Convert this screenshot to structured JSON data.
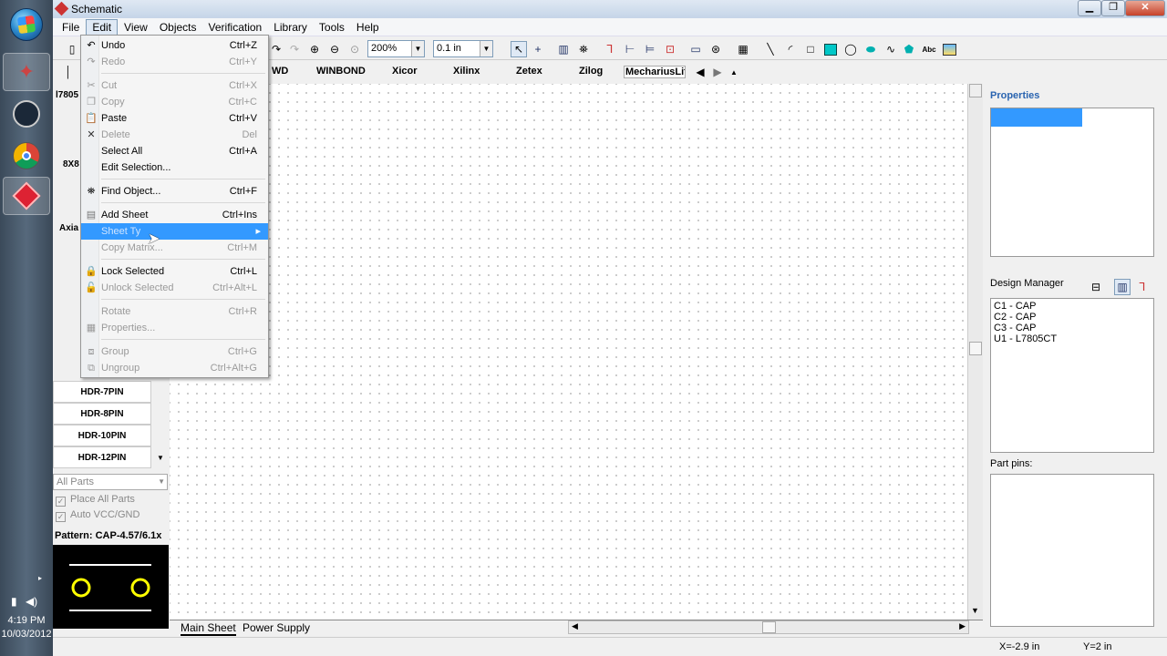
{
  "window": {
    "title": "Schematic"
  },
  "menubar": [
    "File",
    "Edit",
    "View",
    "Objects",
    "Verification",
    "Library",
    "Tools",
    "Help"
  ],
  "toolbar": {
    "zoom": "200%",
    "grid": "0.1 in"
  },
  "library_tabs": [
    "WD",
    "WINBOND",
    "Xicor",
    "Xilinx",
    "Zetex",
    "Zilog",
    "MechariusLit"
  ],
  "edit_menu": {
    "undo": "Undo",
    "undo_sc": "Ctrl+Z",
    "redo": "Redo",
    "redo_sc": "Ctrl+Y",
    "cut": "Cut",
    "cut_sc": "Ctrl+X",
    "copy": "Copy",
    "copy_sc": "Ctrl+C",
    "paste": "Paste",
    "paste_sc": "Ctrl+V",
    "delete": "Delete",
    "delete_sc": "Del",
    "select_all": "Select All",
    "select_all_sc": "Ctrl+A",
    "edit_selection": "Edit Selection...",
    "find_object": "Find Object...",
    "find_object_sc": "Ctrl+F",
    "add_sheet": "Add Sheet",
    "add_sheet_sc": "Ctrl+Ins",
    "sheet_type": "Sheet Ty",
    "copy_matrix": "Copy Matrix...",
    "copy_matrix_sc": "Ctrl+M",
    "lock_selected": "Lock Selected",
    "lock_selected_sc": "Ctrl+L",
    "unlock_selected": "Unlock Selected",
    "unlock_selected_sc": "Ctrl+Alt+L",
    "rotate": "Rotate",
    "rotate_sc": "Ctrl+R",
    "properties": "Properties...",
    "group": "Group",
    "group_sc": "Ctrl+G",
    "ungroup": "Ungroup",
    "ungroup_sc": "Ctrl+Alt+G"
  },
  "left_panel": {
    "partial_rows": [
      "l7805",
      "8X8",
      "Axia"
    ],
    "parts": [
      "HDR-7PIN",
      "HDR-8PIN",
      "HDR-10PIN",
      "HDR-12PIN"
    ],
    "filter": "All Parts",
    "place_all": "Place All Parts",
    "auto_vcc": "Auto VCC/GND",
    "pattern": "Pattern: CAP-4.57/6.1x"
  },
  "sheets": [
    "Main Sheet",
    "Power Supply"
  ],
  "right_panel": {
    "properties_title": "Properties",
    "design_manager_title": "Design Manager",
    "design_items": [
      "C1 - CAP",
      "C2 - CAP",
      "C3 - CAP",
      "U1 - L7805CT"
    ],
    "part_pins_title": "Part pins:"
  },
  "status": {
    "x": "X=-2.9 in",
    "y": "Y=2 in"
  },
  "tray": {
    "time": "4:19 PM",
    "date": "10/03/2012"
  },
  "colors": {
    "accent": "#3399ff",
    "title_blue": "#2a64b0"
  }
}
